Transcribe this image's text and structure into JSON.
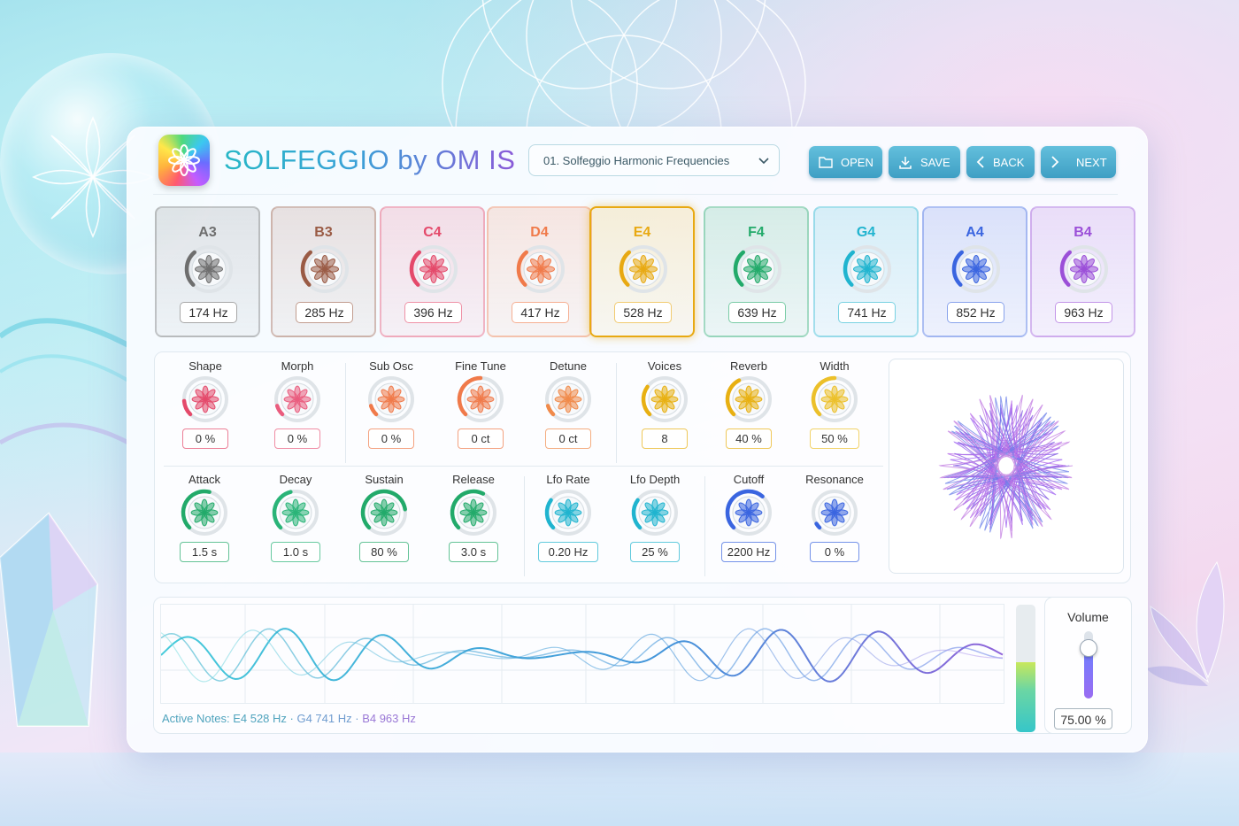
{
  "app": {
    "title": "SOLFEGGIO by OM IS",
    "preset": "01. Solfeggio Harmonic Frequencies"
  },
  "toolbar": {
    "open": "OPEN",
    "save": "SAVE",
    "back": "BACK",
    "next": "NEXT"
  },
  "notes": [
    {
      "name": "A3",
      "freq": "174 Hz",
      "color": "#6e6e6e",
      "selected": false
    },
    {
      "name": "B3",
      "freq": "285 Hz",
      "color": "#9a5b45",
      "selected": false
    },
    {
      "name": "C4",
      "freq": "396 Hz",
      "color": "#e4496a",
      "selected": false
    },
    {
      "name": "D4",
      "freq": "417 Hz",
      "color": "#f07a4a",
      "selected": false
    },
    {
      "name": "E4",
      "freq": "528 Hz",
      "color": "#e8a912",
      "selected": true
    },
    {
      "name": "F4",
      "freq": "639 Hz",
      "color": "#22aa6a",
      "selected": false
    },
    {
      "name": "G4",
      "freq": "741 Hz",
      "color": "#20b4cf",
      "selected": false
    },
    {
      "name": "A4",
      "freq": "852 Hz",
      "color": "#3a65e0",
      "selected": false
    },
    {
      "name": "B4",
      "freq": "963 Hz",
      "color": "#9b4fd8",
      "selected": false
    }
  ],
  "params_row1": [
    {
      "label": "Shape",
      "value": "0 %",
      "color": "#e4496a",
      "level": 0.15
    },
    {
      "label": "Morph",
      "value": "0 %",
      "color": "#ea5c7e",
      "level": 0.1
    },
    {
      "label": "Sub Osc",
      "value": "0 %",
      "color": "#f07a4a",
      "level": 0.1
    },
    {
      "label": "Fine Tune",
      "value": "0 ct",
      "color": "#f07a4a",
      "level": 0.5
    },
    {
      "label": "Detune",
      "value": "0 ct",
      "color": "#f08a4a",
      "level": 0.1
    },
    {
      "label": "Voices",
      "value": "8",
      "color": "#e8b012",
      "level": 0.3
    },
    {
      "label": "Reverb",
      "value": "40 %",
      "color": "#e8b012",
      "level": 0.4
    },
    {
      "label": "Width",
      "value": "50 %",
      "color": "#ecc02a",
      "level": 0.5
    }
  ],
  "params_row2": [
    {
      "label": "Attack",
      "value": "1.5 s",
      "color": "#22aa6a",
      "level": 0.55
    },
    {
      "label": "Decay",
      "value": "1.0 s",
      "color": "#2ab478",
      "level": 0.45
    },
    {
      "label": "Sustain",
      "value": "80 %",
      "color": "#22aa6a",
      "level": 0.8
    },
    {
      "label": "Release",
      "value": "3.0 s",
      "color": "#22aa6a",
      "level": 0.6
    },
    {
      "label": "Lfo Rate",
      "value": "0.20 Hz",
      "color": "#20b4cf",
      "level": 0.3
    },
    {
      "label": "Lfo Depth",
      "value": "25 %",
      "color": "#20b4cf",
      "level": 0.3
    },
    {
      "label": "Cutoff",
      "value": "2200 Hz",
      "color": "#3a65e0",
      "level": 0.65
    },
    {
      "label": "Resonance",
      "value": "0 %",
      "color": "#3a65e0",
      "level": 0.05
    }
  ],
  "active_notes": {
    "prefix": "Active Notes: E4 528 Hz ·",
    "n2": "G4 741 Hz ·",
    "n3": "B4 963 Hz"
  },
  "meter": {
    "level": 0.55
  },
  "volume": {
    "label": "Volume",
    "value": "75.00 %",
    "level": 0.75
  }
}
